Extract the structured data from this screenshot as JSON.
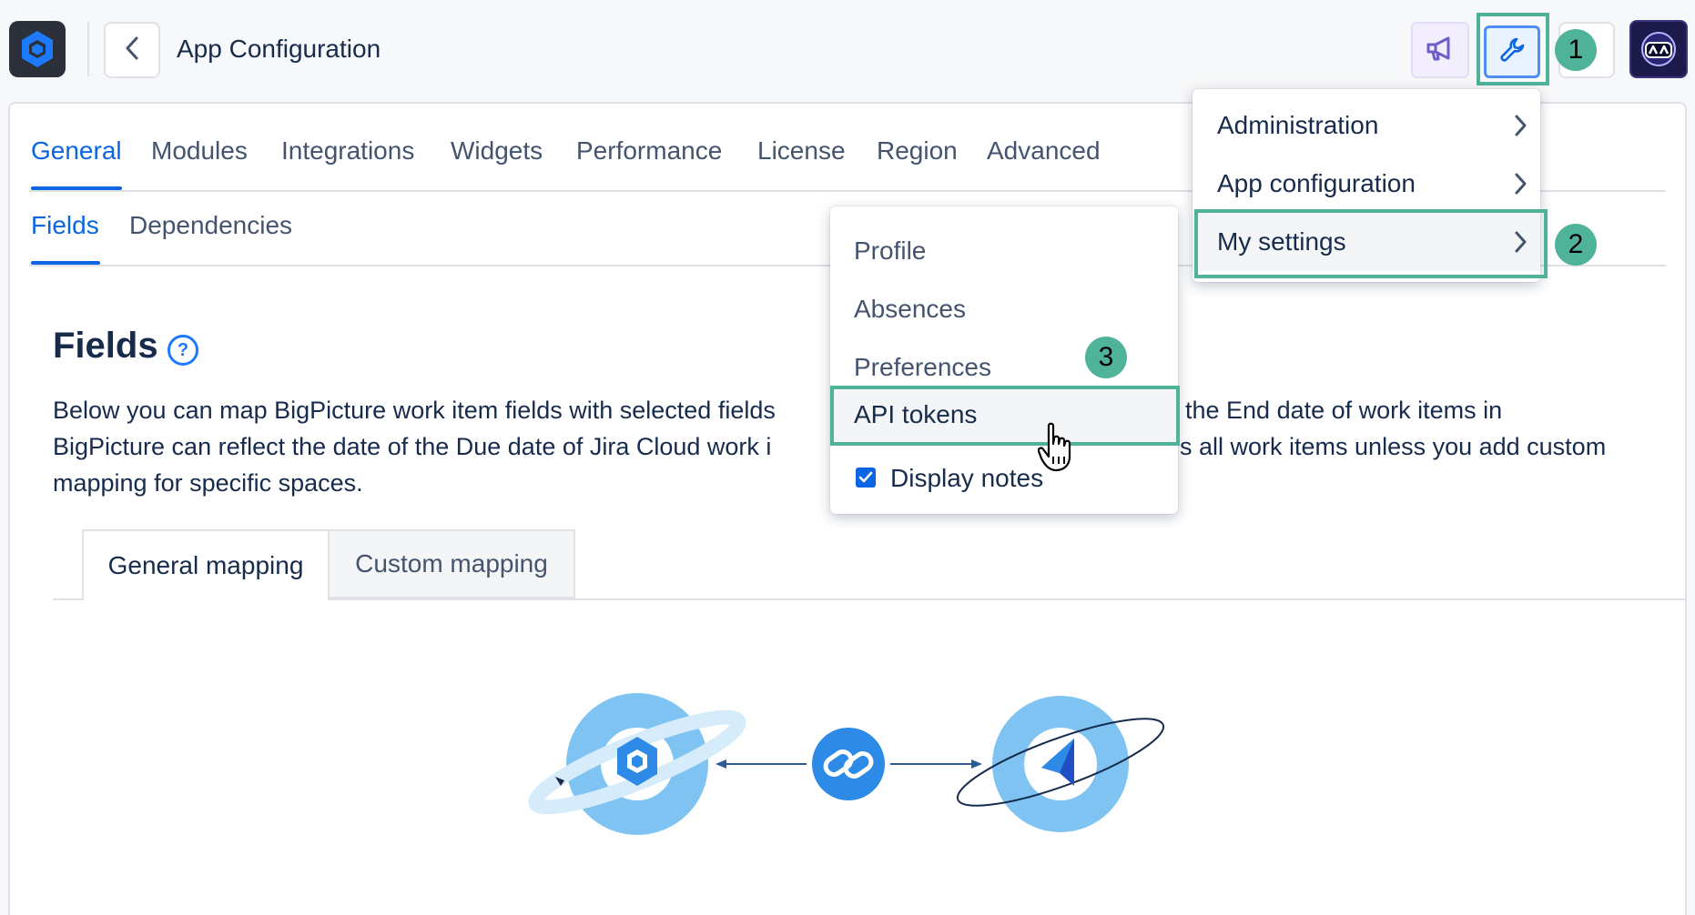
{
  "header": {
    "title": "App Configuration"
  },
  "steps": {
    "one": "1",
    "two": "2",
    "three": "3"
  },
  "tabs": [
    "General",
    "Modules",
    "Integrations",
    "Widgets",
    "Performance",
    "License",
    "Region",
    "Advanced"
  ],
  "subtabs": [
    "Fields",
    "Dependencies"
  ],
  "fields": {
    "title": "Fields",
    "help": "?",
    "desc_line1_a": "Below you can map BigPicture work item fields with selected fields",
    "desc_line1_b": "the End date of work items in",
    "desc_line2_a": "BigPicture can reflect the date of the Due date of Jira Cloud work i",
    "desc_line2_b": "s all work items unless you add custom",
    "desc_line3": "mapping for specific spaces."
  },
  "mapping_tabs": {
    "general": "General mapping",
    "custom": "Custom mapping"
  },
  "main_menu": {
    "items": [
      "Administration",
      "App configuration",
      "My settings"
    ]
  },
  "sub_menu": {
    "items": [
      "Profile",
      "Absences",
      "Preferences",
      "API tokens"
    ],
    "display_notes": "Display notes"
  },
  "icons": {
    "logo": "bigpicture-logo-icon",
    "back": "chevron-left-icon",
    "announce": "megaphone-icon",
    "settings": "wrench-icon",
    "avatar": "avatar-icon",
    "link": "link-icon",
    "cursor": "hand-pointer-icon"
  },
  "colors": {
    "accent": "#0c66e4",
    "highlight": "#4fb39a",
    "illustration_light": "#7ec3f2",
    "illustration_dark": "#2d8ae6"
  }
}
